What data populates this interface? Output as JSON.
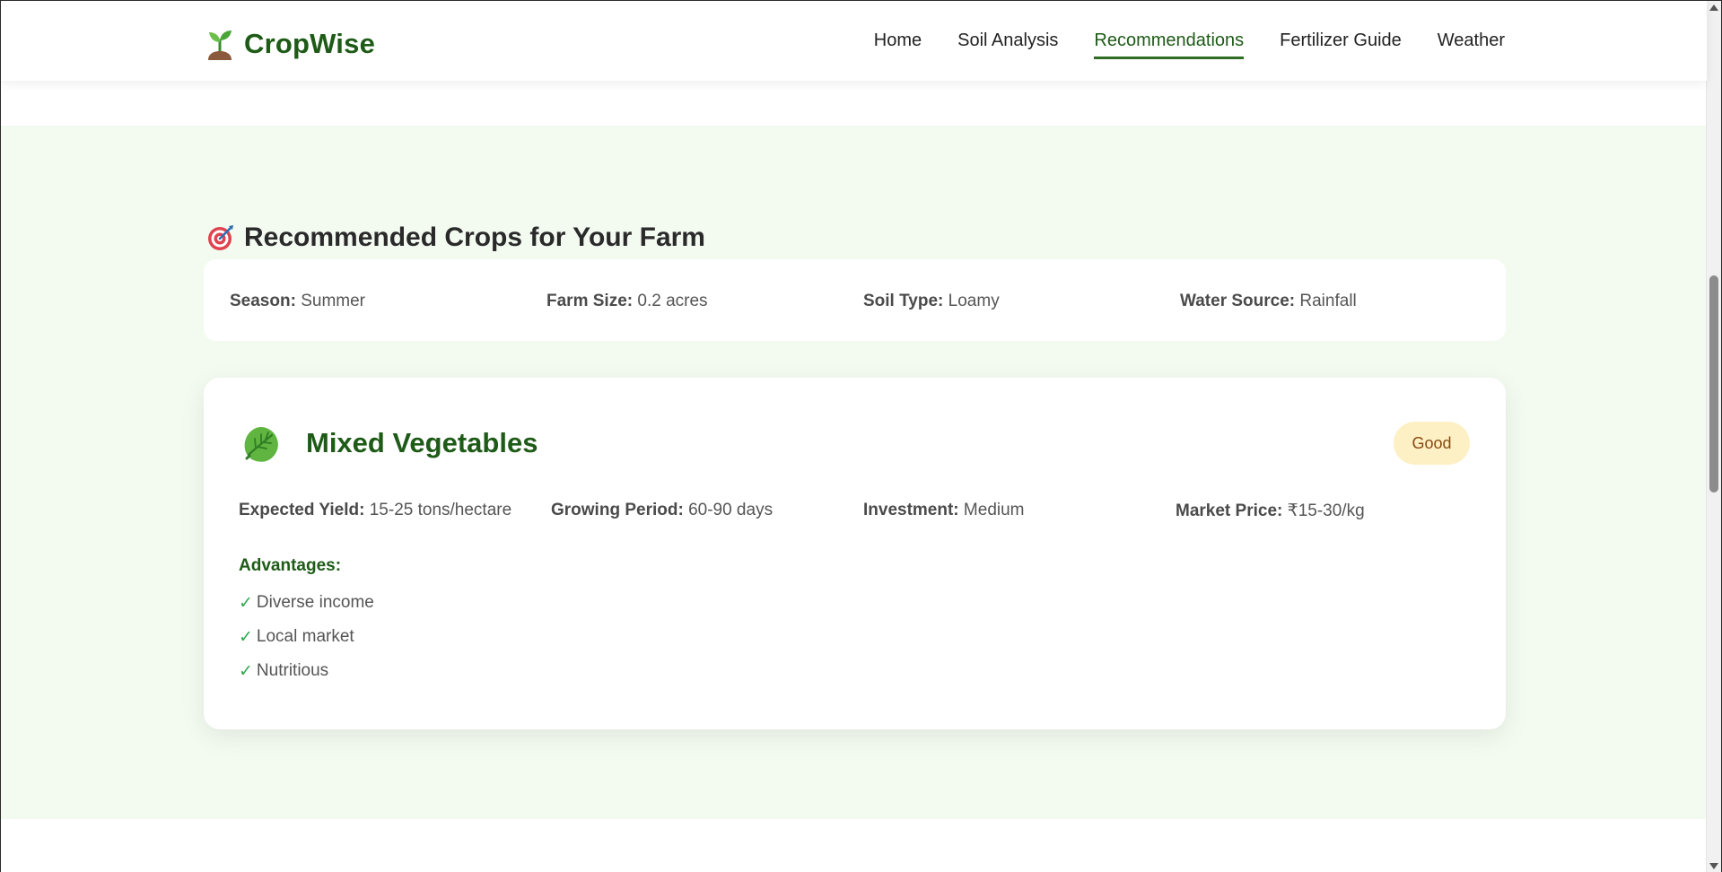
{
  "brand": {
    "name": "CropWise",
    "icon": "seedling-icon"
  },
  "nav": {
    "items": [
      {
        "label": "Home",
        "active": false
      },
      {
        "label": "Soil Analysis",
        "active": false
      },
      {
        "label": "Recommendations",
        "active": true
      },
      {
        "label": "Fertilizer Guide",
        "active": false
      },
      {
        "label": "Weather",
        "active": false
      }
    ]
  },
  "section": {
    "icon": "target-icon",
    "title": "Recommended Crops for Your Farm"
  },
  "farm_info": {
    "season_label": "Season:",
    "season_value": "Summer",
    "size_label": "Farm Size:",
    "size_value": "0.2 acres",
    "soil_label": "Soil Type:",
    "soil_value": "Loamy",
    "water_label": "Water Source:",
    "water_value": "Rainfall"
  },
  "crop": {
    "icon": "leafy-green-icon",
    "name": "Mixed Vegetables",
    "rating": "Good",
    "yield_label": "Expected Yield:",
    "yield_value": "15-25 tons/hectare",
    "period_label": "Growing Period:",
    "period_value": "60-90 days",
    "investment_label": "Investment:",
    "investment_value": "Medium",
    "price_label": "Market Price:",
    "price_value": "₹15-30/kg",
    "advantages_title": "Advantages:",
    "check_glyph": "✓",
    "advantages": [
      "Diverse income",
      "Local market",
      "Nutritious"
    ]
  },
  "colors": {
    "brand_green": "#1e5b17",
    "section_bg": "#f3fbf1",
    "badge_bg": "#fdf0c4",
    "badge_text": "#8a4a12",
    "check_green": "#2fa84f"
  }
}
